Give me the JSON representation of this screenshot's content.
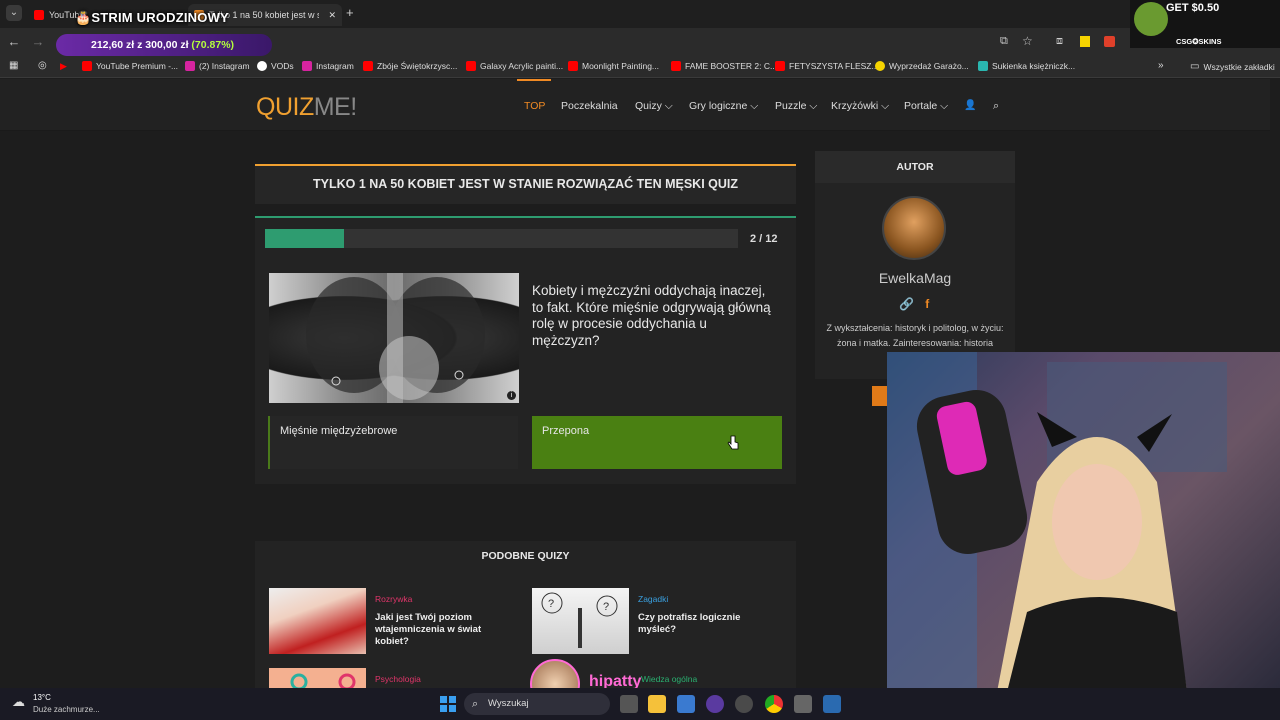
{
  "browser": {
    "tabs": [
      {
        "label": "YouTube",
        "favicon_color": "#ff0000"
      },
      {
        "label": "Tylko 1 na 50 kobiet jest w stanie",
        "favicon_color": "#f08a24"
      }
    ],
    "url": "quizme.pl/…",
    "bookmarks": [
      {
        "label": "YouTube Premium -...",
        "color": "#ff0000"
      },
      {
        "label": "(2) Instagram",
        "color": "#d6249f"
      },
      {
        "label": "VODs",
        "color": "#ffffff"
      },
      {
        "label": "Instagram",
        "color": "#d6249f"
      },
      {
        "label": "Zbóje Świętokrzysc...",
        "color": "#ff0000"
      },
      {
        "label": "Galaxy Acrylic painti...",
        "color": "#ff0000"
      },
      {
        "label": "Moonlight Painting...",
        "color": "#ff0000"
      },
      {
        "label": "FAME BOOSTER 2: C...",
        "color": "#ff0000"
      },
      {
        "label": "FETYSZYSTA FLESZ...",
        "color": "#ff0000"
      },
      {
        "label": "Wyprzedaż Garażo...",
        "color": "#f5d300"
      },
      {
        "label": "Sukienka księżniczk...",
        "color": "#2ab7b0"
      }
    ],
    "all_bookmarks_label": "Wszystkie zakładki"
  },
  "overlay": {
    "birthday_banner": "STRIM URODZINOWY",
    "donation_amount": "212,60 zł",
    "donation_sep": "z",
    "donation_goal": "300,00 zł",
    "donation_pct": "(70.87%)",
    "csg_promo": "GET $0.50",
    "csg_brand": "CSG✪SKINS",
    "streamer_handle": "hipatty"
  },
  "site": {
    "logo_a": "QUIZ",
    "logo_b": "ME!",
    "nav": [
      {
        "label": "TOP",
        "active": true
      },
      {
        "label": "Poczekalnia"
      },
      {
        "label": "Quizy ⌵"
      },
      {
        "label": "Gry logiczne ⌵"
      },
      {
        "label": "Puzzle ⌵"
      },
      {
        "label": "Krzyżówki ⌵"
      },
      {
        "label": "Portale ⌵"
      }
    ]
  },
  "quiz": {
    "title": "TYLKO 1 NA 50 KOBIET JEST W STANIE ROZWIĄZAĆ TEN MĘSKI QUIZ",
    "progress": {
      "current": 2,
      "total": 12,
      "label": "2 / 12"
    },
    "question": "Kobiety i mężczyźni oddychają inaczej, to fakt. Które mięśnie odgrywają główną rolę w procesie oddychania u mężczyzn?",
    "answers": [
      {
        "label": "Mięśnie międzyżebrowe",
        "selected": false
      },
      {
        "label": "Przepona",
        "selected": true
      }
    ]
  },
  "similar": {
    "heading": "PODOBNE QUIZY",
    "items": [
      {
        "category": "Rozrywka",
        "category_color": "#e0356a",
        "title": "Jaki jest Twój poziom wtajemniczenia w świat kobiet?"
      },
      {
        "category": "Zagadki",
        "category_color": "#3aa0e0",
        "title": "Czy potrafisz logicznie myśleć?"
      },
      {
        "category": "Psychologia",
        "category_color": "#e0356a",
        "title": ""
      },
      {
        "category": "Wiedza ogólna",
        "category_color": "#2ab070",
        "title": ""
      }
    ]
  },
  "author": {
    "heading": "AUTOR",
    "name": "EwelkaMag",
    "description": "Z wykształcenia: historyk i politolog, w życiu: żona i matka. Zainteresowania: historia"
  },
  "taskbar": {
    "temperature": "13°C",
    "weather": "Duże zachmurze...",
    "search_placeholder": "Wyszukaj"
  }
}
